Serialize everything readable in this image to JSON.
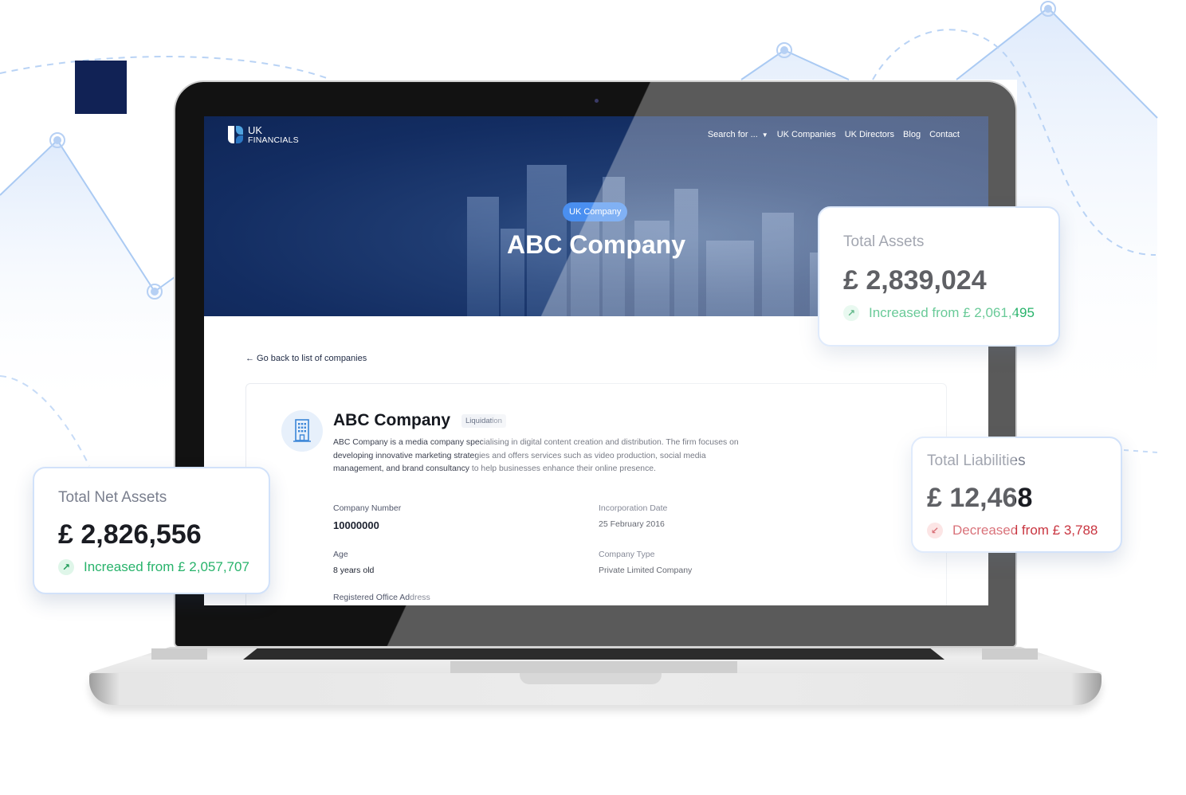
{
  "colors": {
    "brand_navy": "#112255",
    "accent_blue": "#4a8ff0",
    "increase_green": "#28b36b",
    "decrease_red": "#c93540"
  },
  "site": {
    "logo": {
      "line1": "UK",
      "line2": "FINANCIALS"
    },
    "nav": [
      {
        "label": "Search for ...",
        "has_dropdown": true
      },
      {
        "label": "UK Companies"
      },
      {
        "label": "UK Directors"
      },
      {
        "label": "Blog"
      },
      {
        "label": "Contact"
      }
    ],
    "hero": {
      "badge": "UK Company",
      "title": "ABC Company"
    },
    "back_link": "← Go back to list of companies",
    "company": {
      "icon": "building-icon",
      "name": "ABC Company",
      "status": "Liquidation",
      "description": "ABC Company is a media company specialising in digital content creation and distribution. The firm focuses on developing innovative marketing strategies and offers services such as video production, social media management, and brand consultancy to help businesses enhance their online presence.",
      "fields": {
        "company_number": {
          "label": "Company Number",
          "value": "10000000"
        },
        "incorporation_date": {
          "label": "Incorporation Date",
          "value": "25 February 2016"
        },
        "age": {
          "label": "Age",
          "value": "8 years old"
        },
        "company_type": {
          "label": "Company Type",
          "value": "Private Limited Company"
        },
        "registered_office": {
          "label": "Registered Office Address"
        }
      }
    }
  },
  "stats": {
    "total_assets": {
      "title": "Total Assets",
      "value": "£ 2,839,024",
      "delta": "Increased from £ 2,061,495",
      "direction": "up",
      "icon": "arrow-up-right-icon"
    },
    "total_net_assets": {
      "title": "Total Net Assets",
      "value": "£ 2,826,556",
      "delta": "Increased from £ 2,057,707",
      "direction": "up",
      "icon": "arrow-up-right-icon"
    },
    "total_liabilities": {
      "title": "Total Liabilities",
      "value": "£ 12,468",
      "delta": "Decreased from £ 3,788",
      "direction": "down",
      "icon": "arrow-down-left-icon"
    }
  },
  "icons": {
    "up": "↗",
    "down": "↙",
    "caret": "▼"
  }
}
